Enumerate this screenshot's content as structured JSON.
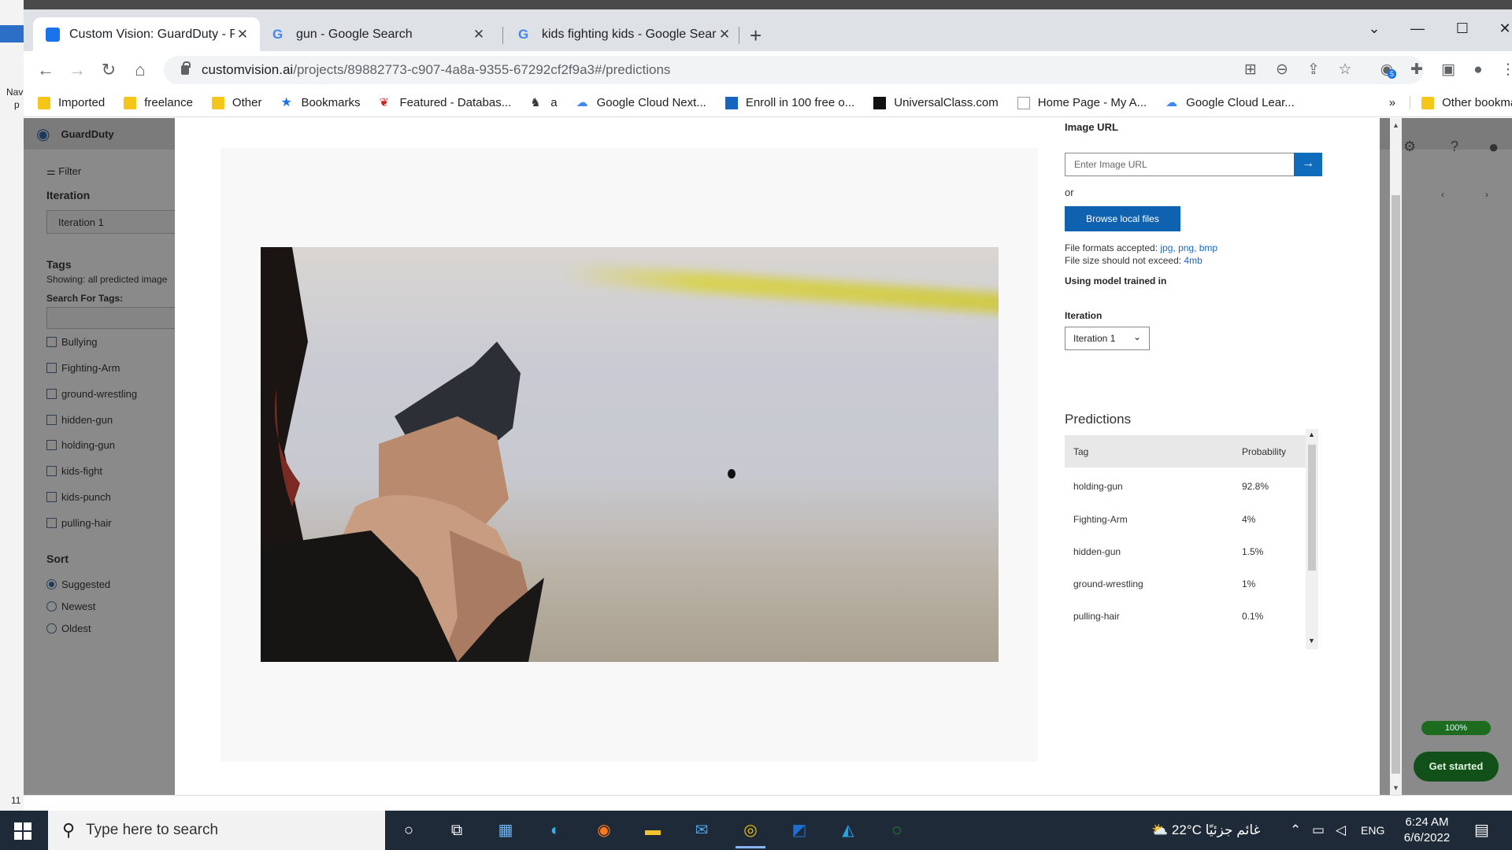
{
  "browser": {
    "tabs": [
      {
        "title": "Custom Vision: GuardDuty - Pred",
        "active": true
      },
      {
        "title": "gun - Google Search",
        "active": false
      },
      {
        "title": "kids fighting kids - Google Searc",
        "active": false
      }
    ],
    "url_host": "customvision.ai",
    "url_path": "/projects/89882773-c907-4a8a-9355-67292cf2f9a3#/predictions",
    "bookmarks": [
      {
        "label": "Imported",
        "icon": "folder-icon"
      },
      {
        "label": "freelance",
        "icon": "folder-icon"
      },
      {
        "label": "Other",
        "icon": "folder-icon"
      },
      {
        "label": "Bookmarks",
        "icon": "star-icon"
      },
      {
        "label": "Featured - Databas...",
        "icon": "database-icon"
      },
      {
        "label": "a",
        "icon": "person-icon"
      },
      {
        "label": "Google Cloud Next...",
        "icon": "cloud-icon"
      },
      {
        "label": "Enroll in 100 free o...",
        "icon": "enroll-icon"
      },
      {
        "label": "UniversalClass.com",
        "icon": "universalclass-icon"
      },
      {
        "label": "Home Page - My A...",
        "icon": "page-icon"
      },
      {
        "label": "Google Cloud Lear...",
        "icon": "cloud-icon"
      }
    ],
    "other_bookmarks": "Other bookmar",
    "extension_badge": "5"
  },
  "cv": {
    "project_name": "GuardDuty",
    "filter_label": "Filter",
    "iteration_heading": "Iteration",
    "iteration_value": "Iteration 1",
    "tags_heading": "Tags",
    "tags_showing": "Showing: all predicted image",
    "search_tags_label": "Search For Tags:",
    "tags": [
      "Bullying",
      "Fighting-Arm",
      "ground-wrestling",
      "hidden-gun",
      "holding-gun",
      "kids-fight",
      "kids-punch",
      "pulling-hair"
    ],
    "sort_heading": "Sort",
    "sort_options": [
      {
        "label": "Suggested",
        "selected": true
      },
      {
        "label": "Newest",
        "selected": false
      },
      {
        "label": "Oldest",
        "selected": false
      }
    ],
    "progress_badge": "100%",
    "get_started": "Get started"
  },
  "modal": {
    "image_url_label": "Image URL",
    "image_url_placeholder": "Enter Image URL",
    "or_text": "or",
    "browse_label": "Browse local files",
    "formats_prefix": "File formats accepted: ",
    "formats_value": "jpg, png, bmp",
    "size_prefix": "File size should not exceed: ",
    "size_value": "4mb",
    "model_label": "Using model trained in",
    "iteration_label": "Iteration",
    "iteration_value": "Iteration 1",
    "predictions_title": "Predictions",
    "col_tag": "Tag",
    "col_probability": "Probability",
    "predictions": [
      {
        "tag": "holding-gun",
        "probability": "92.8%"
      },
      {
        "tag": "Fighting-Arm",
        "probability": "4%"
      },
      {
        "tag": "hidden-gun",
        "probability": "1.5%"
      },
      {
        "tag": "ground-wrestling",
        "probability": "1%"
      },
      {
        "tag": "pulling-hair",
        "probability": "0.1%"
      }
    ]
  },
  "desktop": {
    "left_labels": [
      "Nav",
      "p",
      "11"
    ]
  },
  "taskbar": {
    "search_placeholder": "Type here to search",
    "weather": "22°C  غائم جزئيًا",
    "language": "ENG",
    "time": "6:24 AM",
    "date": "6/6/2022"
  }
}
